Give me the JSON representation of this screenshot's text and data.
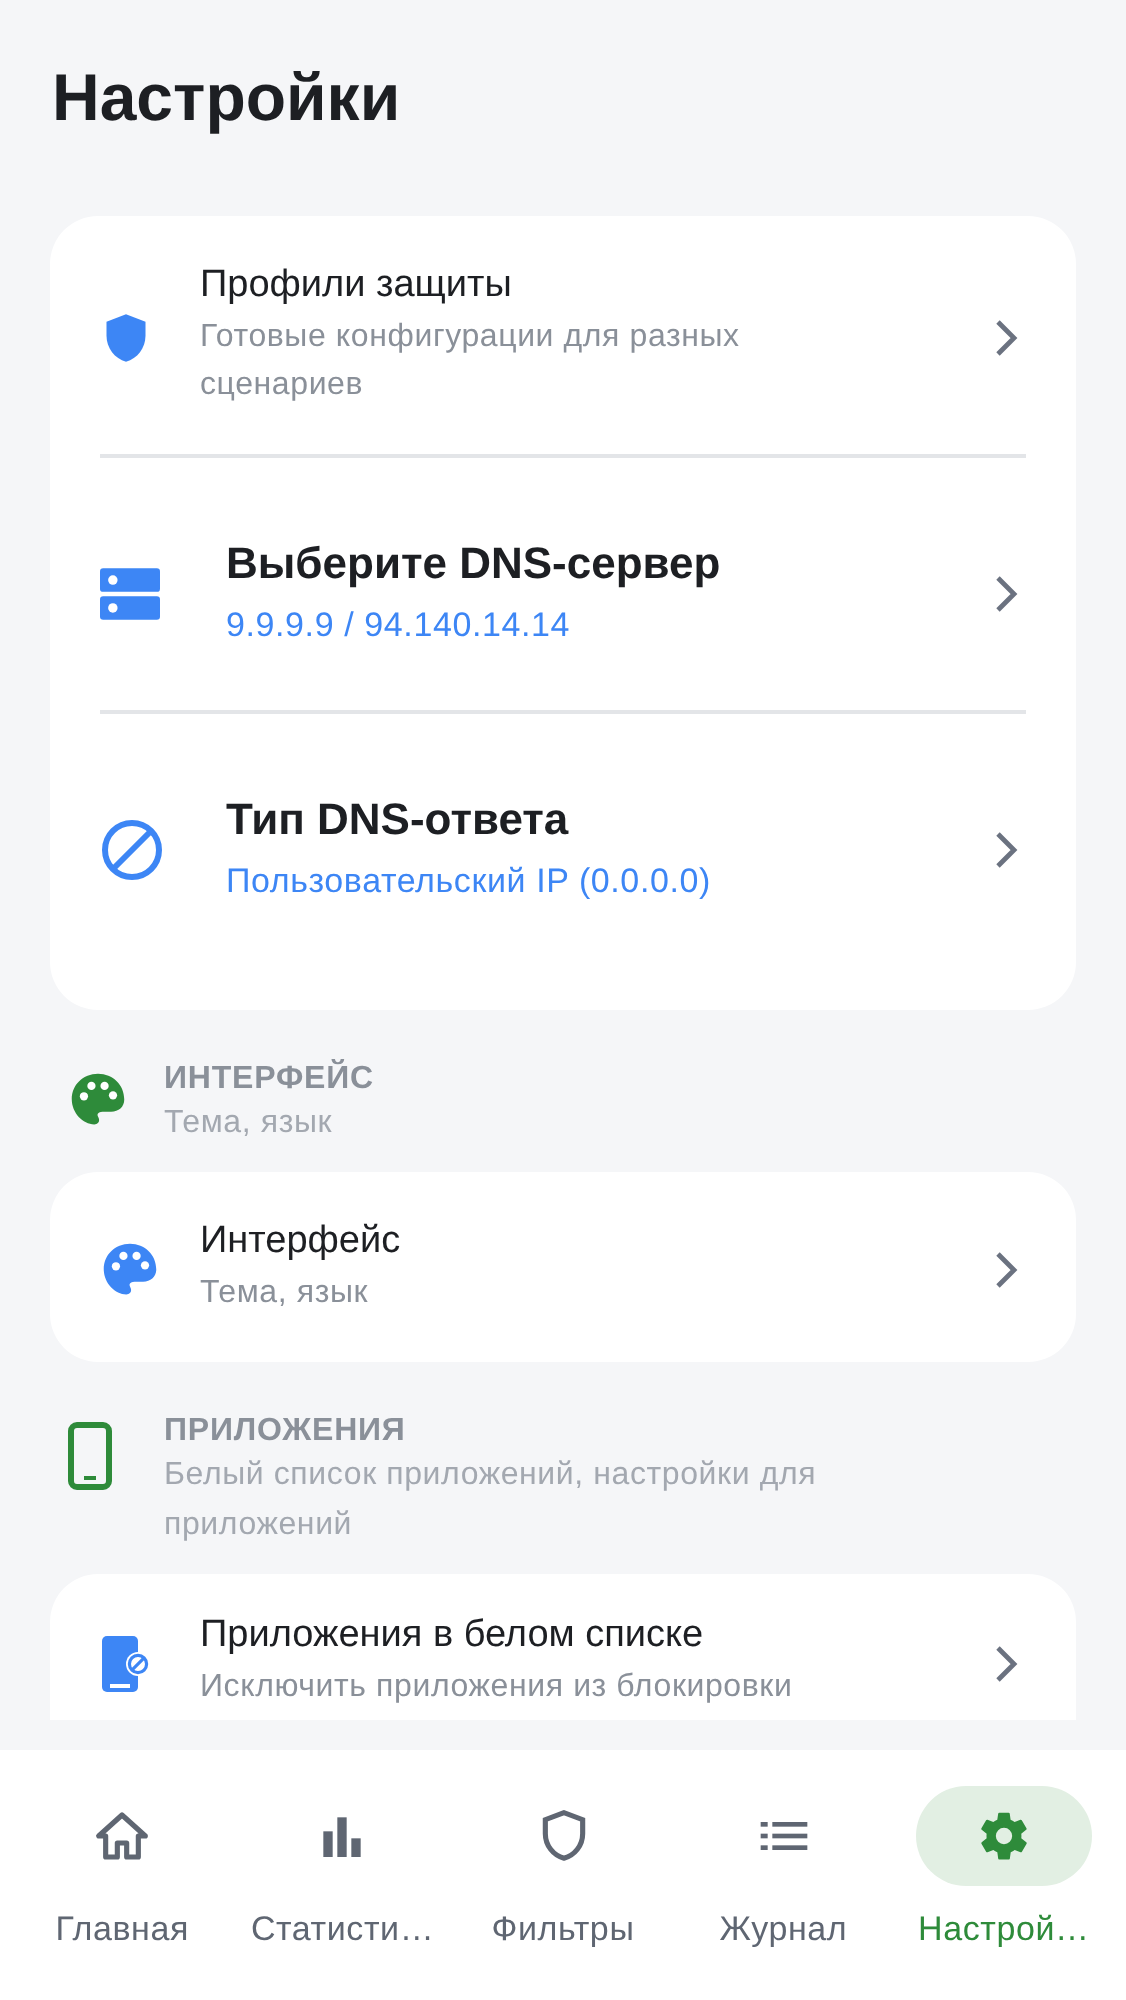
{
  "header": {
    "title": "Настройки"
  },
  "groups": [
    {
      "rows": [
        {
          "kind": "compact",
          "title": "Профили защиты",
          "subtitle": "Готовые конфигурации для разных сценариев",
          "accent": false
        },
        {
          "kind": "large",
          "title": "Выберите DNS-сервер",
          "subtitle": "9.9.9.9 / 94.140.14.14",
          "accent": true
        },
        {
          "kind": "large",
          "title": "Тип DNS-ответа",
          "subtitle": "Пользовательский IP (0.0.0.0)",
          "accent": true
        }
      ]
    },
    {
      "section": {
        "title": "ИНТЕРФЕЙС",
        "subtitle": "Тема, язык"
      },
      "rows": [
        {
          "kind": "compact",
          "title": "Интерфейс",
          "subtitle": "Тема, язык",
          "accent": false
        }
      ]
    },
    {
      "section": {
        "title": "ПРИЛОЖЕНИЯ",
        "subtitle": "Белый список приложений, настройки для приложений"
      },
      "rows": [
        {
          "kind": "compact",
          "title": "Приложения в белом списке",
          "subtitle": "Исключить приложения из блокировки",
          "accent": false
        }
      ]
    }
  ],
  "bottom_nav": [
    {
      "label": "Главная",
      "selected": false
    },
    {
      "label": "Статисти…",
      "selected": false
    },
    {
      "label": "Фильтры",
      "selected": false
    },
    {
      "label": "Журнал",
      "selected": false
    },
    {
      "label": "Настрой…",
      "selected": true
    }
  ]
}
